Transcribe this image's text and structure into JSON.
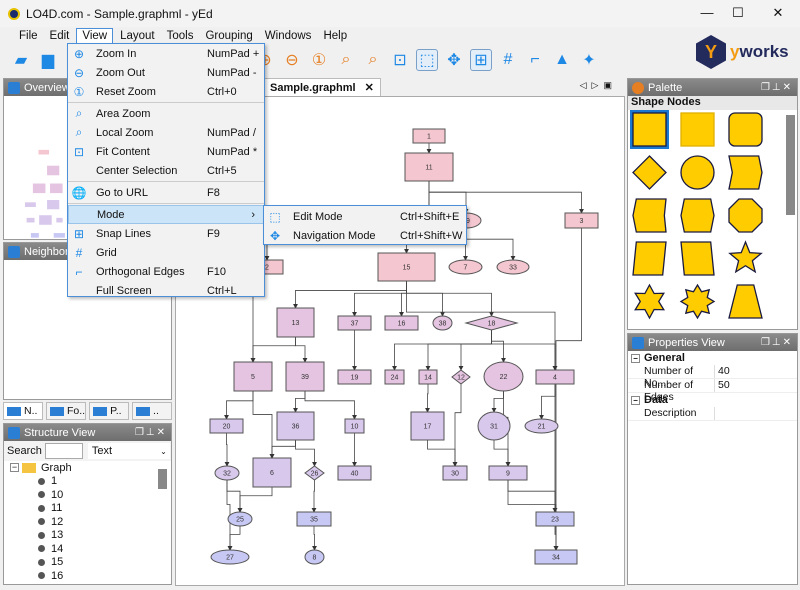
{
  "window": {
    "title": "LO4D.com - Sample.graphml - yEd",
    "minimize": "—",
    "maximize": "☐",
    "close": "✕"
  },
  "menubar": [
    "File",
    "Edit",
    "View",
    "Layout",
    "Tools",
    "Grouping",
    "Windows",
    "Help"
  ],
  "toolbar_icons": [
    "new-document-icon",
    "open-icon",
    "zoom-in-icon",
    "zoom-out-icon",
    "reset-zoom-icon",
    "area-zoom-icon",
    "local-zoom-icon",
    "fit-content-icon",
    "edit-mode-icon",
    "navigation-mode-icon",
    "snap-lines-icon",
    "grid-icon",
    "orthogonal-edges-icon",
    "layout-icon",
    "magic-wand-icon"
  ],
  "brand": {
    "name_y": "y",
    "name_rest": "works",
    "colors": {
      "navy": "#232a5c",
      "orange": "#f39c12"
    }
  },
  "view_menu": {
    "items": [
      {
        "label": "Zoom In",
        "shortcut": "NumPad +",
        "icon": "zoom-in-icon"
      },
      {
        "label": "Zoom Out",
        "shortcut": "NumPad -",
        "icon": "zoom-out-icon"
      },
      {
        "label": "Reset Zoom",
        "shortcut": "Ctrl+0",
        "icon": "reset-zoom-icon",
        "sep_after": true
      },
      {
        "label": "Area Zoom",
        "shortcut": "",
        "icon": "area-zoom-icon"
      },
      {
        "label": "Local Zoom",
        "shortcut": "NumPad /",
        "icon": "local-zoom-icon"
      },
      {
        "label": "Fit Content",
        "shortcut": "NumPad *",
        "icon": "fit-content-icon"
      },
      {
        "label": "Center Selection",
        "shortcut": "Ctrl+5",
        "icon": "",
        "sep_after": true
      },
      {
        "label": "Go to URL",
        "shortcut": "F8",
        "icon": "globe-icon",
        "sep_after": true
      },
      {
        "label": "Mode",
        "shortcut": "",
        "icon": "",
        "submenu": true
      },
      {
        "label": "Snap Lines",
        "shortcut": "F9",
        "icon": "snap-lines-icon"
      },
      {
        "label": "Grid",
        "shortcut": "",
        "icon": "grid-icon"
      },
      {
        "label": "Orthogonal Edges",
        "shortcut": "F10",
        "icon": "orthogonal-edges-icon"
      },
      {
        "label": "Full Screen",
        "shortcut": "Ctrl+L",
        "icon": ""
      }
    ]
  },
  "mode_submenu": [
    {
      "label": "Edit Mode",
      "shortcut": "Ctrl+Shift+E",
      "icon": "edit-mode-icon"
    },
    {
      "label": "Navigation Mode",
      "shortcut": "Ctrl+Shift+W",
      "icon": "navigation-mode-icon"
    }
  ],
  "panels": {
    "overview": "Overview",
    "neighborhood": "Neighborh",
    "dock_tabs": [
      "N..",
      "Fo..",
      "P..",
      ".."
    ],
    "structure": "Structure View",
    "palette": "Palette",
    "properties": "Properties View"
  },
  "structure": {
    "search_label": "Search",
    "search_value": "",
    "filter": "Text",
    "root": "Graph",
    "items": [
      "1",
      "10",
      "11",
      "12",
      "13",
      "14",
      "15",
      "16"
    ]
  },
  "editor": {
    "tab": "Sample.graphml",
    "close": "✕"
  },
  "palette": {
    "section": "Shape Nodes",
    "shapes": [
      "rectangle",
      "rectangle-plain",
      "round-rectangle",
      "diamond",
      "ellipse",
      "banner",
      "fat-arrow-left",
      "hexagon",
      "octagon",
      "parallelogram",
      "parallelogram-reverse",
      "star5",
      "star6",
      "star8",
      "trapezoid"
    ],
    "fill": "#ffcc00"
  },
  "properties": {
    "sections": [
      {
        "name": "General",
        "rows": [
          {
            "key": "Number of No...",
            "value": "40"
          },
          {
            "key": "Number of Edges",
            "value": "50"
          }
        ]
      },
      {
        "name": "Data",
        "rows": [
          {
            "key": "Description",
            "value": ""
          }
        ]
      }
    ]
  },
  "graph": {
    "nodes": [
      "1",
      "11",
      "3",
      "2",
      "7",
      "33",
      "15",
      "13",
      "37",
      "16",
      "38",
      "18",
      "5",
      "39",
      "19",
      "24",
      "14",
      "12",
      "22",
      "4",
      "20",
      "36",
      "10",
      "17",
      "31",
      "21",
      "32",
      "6",
      "26",
      "40",
      "30",
      "9",
      "25",
      "35",
      "23",
      "27",
      "8",
      "34",
      "29"
    ],
    "edges": [
      [
        "1",
        "11"
      ],
      [
        "11",
        "3"
      ],
      [
        "11",
        "29"
      ],
      [
        "11",
        "15"
      ],
      [
        "11",
        "2"
      ],
      [
        "11",
        "5"
      ],
      [
        "29",
        "7"
      ],
      [
        "29",
        "33"
      ],
      [
        "15",
        "13"
      ],
      [
        "15",
        "37"
      ],
      [
        "15",
        "16"
      ],
      [
        "15",
        "38"
      ],
      [
        "15",
        "18"
      ],
      [
        "15",
        "4"
      ],
      [
        "13",
        "5"
      ],
      [
        "13",
        "39"
      ],
      [
        "3",
        "34"
      ],
      [
        "18",
        "24"
      ],
      [
        "18",
        "14"
      ],
      [
        "18",
        "12"
      ],
      [
        "18",
        "22"
      ],
      [
        "18",
        "4"
      ],
      [
        "39",
        "36"
      ],
      [
        "39",
        "10"
      ],
      [
        "37",
        "19"
      ],
      [
        "5",
        "20"
      ],
      [
        "5",
        "6"
      ],
      [
        "36",
        "6"
      ],
      [
        "36",
        "26"
      ],
      [
        "10",
        "40"
      ],
      [
        "14",
        "17"
      ],
      [
        "17",
        "30"
      ],
      [
        "12",
        "30"
      ],
      [
        "22",
        "31"
      ],
      [
        "22",
        "9"
      ],
      [
        "31",
        "9"
      ],
      [
        "4",
        "21"
      ],
      [
        "4",
        "23"
      ],
      [
        "20",
        "32"
      ],
      [
        "32",
        "25"
      ],
      [
        "32",
        "27"
      ],
      [
        "6",
        "25"
      ],
      [
        "25",
        "27"
      ],
      [
        "26",
        "35"
      ],
      [
        "35",
        "8"
      ],
      [
        "9",
        "23"
      ],
      [
        "9",
        "34"
      ],
      [
        "23",
        "34"
      ]
    ],
    "colors": {
      "top": "#f4c6d0",
      "mid": "#e4c4e0",
      "low": "#d8c8ec",
      "bottom": "#c8c8f4",
      "stroke": "#555555"
    }
  }
}
